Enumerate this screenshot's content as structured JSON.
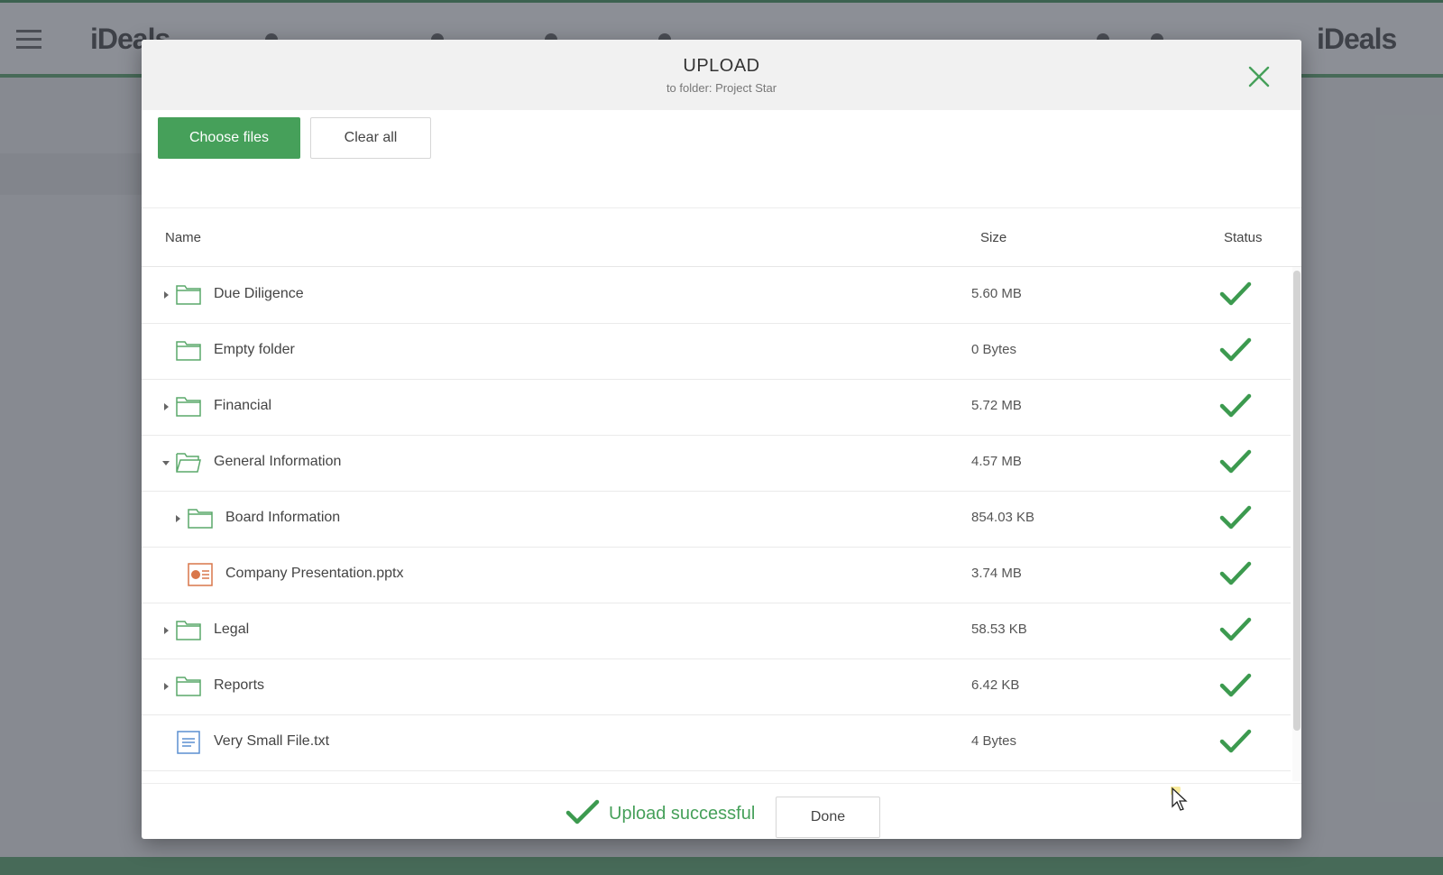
{
  "modal": {
    "title": "UPLOAD",
    "subtitle": "to folder: Project Star",
    "close_icon": "close-icon"
  },
  "toolbar": {
    "choose_files_label": "Choose files",
    "clear_all_label": "Clear all"
  },
  "table": {
    "columns": {
      "name": "Name",
      "size": "Size",
      "status": "Status"
    },
    "rows": [
      {
        "name": "Due Diligence",
        "size": "5.60 MB",
        "icon": "folder-icon",
        "expander": "collapsed",
        "level": 0,
        "status": "check-icon"
      },
      {
        "name": "Empty folder",
        "size": "0 Bytes",
        "icon": "folder-icon",
        "expander": "none",
        "level": 0,
        "status": "check-icon"
      },
      {
        "name": "Financial",
        "size": "5.72 MB",
        "icon": "folder-icon",
        "expander": "collapsed",
        "level": 0,
        "status": "check-icon"
      },
      {
        "name": "General Information",
        "size": "4.57 MB",
        "icon": "folder-open-icon",
        "expander": "expanded",
        "level": 0,
        "status": "check-icon"
      },
      {
        "name": "Board Information",
        "size": "854.03 KB",
        "icon": "folder-icon",
        "expander": "collapsed",
        "level": 1,
        "status": "check-icon"
      },
      {
        "name": "Company Presentation.pptx",
        "size": "3.74 MB",
        "icon": "pptx-file-icon",
        "expander": "none",
        "level": 1,
        "status": "check-icon"
      },
      {
        "name": "Legal",
        "size": "58.53 KB",
        "icon": "folder-icon",
        "expander": "collapsed",
        "level": 0,
        "status": "check-icon"
      },
      {
        "name": "Reports",
        "size": "6.42 KB",
        "icon": "folder-icon",
        "expander": "collapsed",
        "level": 0,
        "status": "check-icon"
      },
      {
        "name": "Very Small File.txt",
        "size": "4 Bytes",
        "icon": "txt-file-icon",
        "expander": "none",
        "level": 0,
        "status": "check-icon"
      }
    ]
  },
  "footer": {
    "status_text": "Upload successful",
    "done_label": "Done"
  },
  "colors": {
    "accent": "#46a05a",
    "check": "#3c9a4f",
    "folder": "#5aa86a",
    "pptx": "#d9774a",
    "txt": "#5b8fd1"
  }
}
